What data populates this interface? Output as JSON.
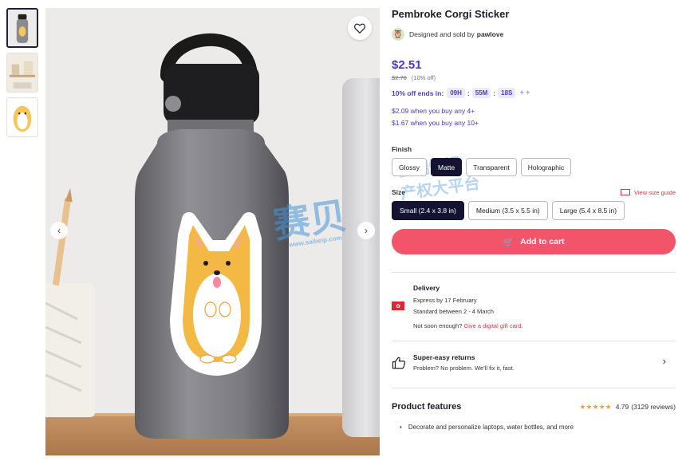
{
  "product": {
    "title": "Pembroke Corgi Sticker",
    "seller_prefix": "Designed and sold by",
    "seller_name": "pawlove"
  },
  "pricing": {
    "price": "$2.51",
    "original_price": "$2.78",
    "discount_note": "(10% off)",
    "sale_label": "10% off ends in:",
    "timer_hours": "09H",
    "timer_minutes": "55M",
    "timer_seconds": "18S",
    "bulk": [
      "$2.09 when you buy any 4+",
      "$1.67 when you buy any 10+"
    ]
  },
  "finish": {
    "label": "Finish",
    "options": [
      "Glossy",
      "Matte",
      "Transparent",
      "Holographic"
    ],
    "selected": "Matte"
  },
  "size": {
    "label": "Size",
    "guide_label": "View size guide",
    "options": [
      "Small (2.4 x 3.8 in)",
      "Medium (3.5 x 5.5 in)",
      "Large (5.4 x 8.5 in)"
    ],
    "selected": "Small (2.4 x 3.8 in)"
  },
  "cart": {
    "label": "Add to cart"
  },
  "delivery": {
    "heading": "Delivery",
    "express": "Express by 17 February",
    "standard": "Standard between 2 - 4 March",
    "not_soon": "Not soon enough?",
    "gift_link": "Give a digital gift card."
  },
  "returns": {
    "heading": "Super-easy returns",
    "text": "Problem? No problem. We'll fix it, fast."
  },
  "features": {
    "heading": "Product features",
    "stars": "★★★★★",
    "rating": "4.79",
    "reviews": "(3129 reviews)",
    "bullets": [
      "Decorate and personalize laptops, water bottles, and more"
    ]
  },
  "watermark": {
    "brand": "赛贝",
    "url": "www.saibeip.com",
    "line1": "云端知识",
    "line2": "产权大平台"
  },
  "colors": {
    "accent": "#4a39c4",
    "cart": "#f2546a",
    "selected_option": "#141432",
    "link_red": "#d2364b"
  },
  "icons": [
    "heart-icon",
    "chevron-left-icon",
    "chevron-right-icon",
    "cart-icon",
    "ruler-icon",
    "flag-icon",
    "thumbs-up-icon",
    "chevron-right-icon"
  ]
}
